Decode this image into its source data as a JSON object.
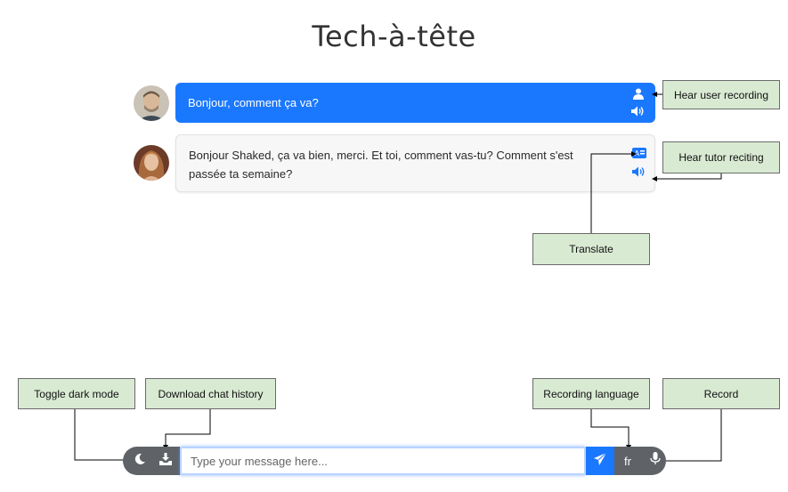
{
  "app": {
    "title": "Tech-à-tête"
  },
  "messages": [
    {
      "role": "user",
      "text": "Bonjour, comment ça va?",
      "icons": [
        "user-icon",
        "speaker-icon"
      ]
    },
    {
      "role": "tutor",
      "text": "Bonjour Shaked, ça va bien, merci. Et toi, comment vas-tu? Comment s'est passée ta semaine?",
      "icons": [
        "translate-icon",
        "speaker-icon"
      ]
    }
  ],
  "callouts": {
    "hear_user_recording": "Hear user recording",
    "hear_tutor_reciting": "Hear tutor reciting",
    "translate": "Translate",
    "toggle_dark_mode": "Toggle dark mode",
    "download_chat_history": "Download chat history",
    "recording_language": "Recording language",
    "record": "Record"
  },
  "toolbar": {
    "input_placeholder": "Type your message here...",
    "input_value": "",
    "language": "fr",
    "icons": [
      "moon-icon",
      "download-icon",
      "send-icon",
      "microphone-icon"
    ]
  },
  "colors": {
    "accent": "#1a78ff",
    "toolbar_bg": "#5f6368",
    "callout_bg": "#d9ead3",
    "tutor_bubble_bg": "#f7f7f8"
  }
}
